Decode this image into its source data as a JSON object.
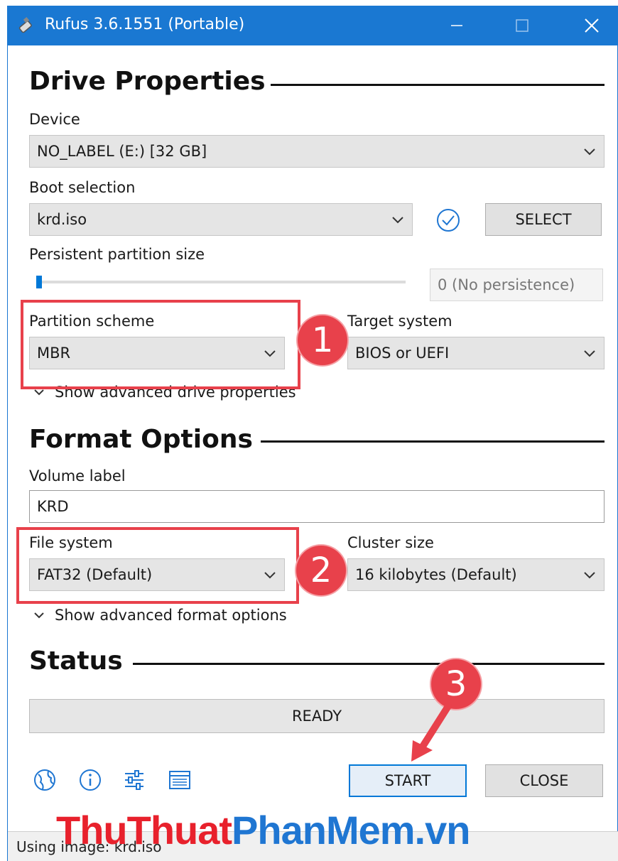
{
  "window": {
    "title": "Rufus 3.6.1551 (Portable)",
    "accent_color": "#1a78d2"
  },
  "drive_properties": {
    "heading": "Drive Properties",
    "device_label": "Device",
    "device_value": "NO_LABEL (E:) [32 GB]",
    "boot_selection_label": "Boot selection",
    "boot_selection_value": "krd.iso",
    "select_button": "SELECT",
    "persistent_label": "Persistent partition size",
    "persistent_value": "0 (No persistence)",
    "partition_scheme_label": "Partition scheme",
    "partition_scheme_value": "MBR",
    "target_system_label": "Target system",
    "target_system_value": "BIOS or UEFI",
    "advanced_toggle": "Show advanced drive properties"
  },
  "format_options": {
    "heading": "Format Options",
    "volume_label_label": "Volume label",
    "volume_label_value": "KRD",
    "file_system_label": "File system",
    "file_system_value": "FAT32 (Default)",
    "cluster_size_label": "Cluster size",
    "cluster_size_value": "16 kilobytes (Default)",
    "advanced_toggle": "Show advanced format options"
  },
  "status": {
    "heading": "Status",
    "text": "READY"
  },
  "actions": {
    "start": "START",
    "close": "CLOSE"
  },
  "toolbar_icons": [
    "globe-icon",
    "info-icon",
    "settings-icon",
    "log-icon"
  ],
  "footer": {
    "text": "Using image: krd.iso"
  },
  "annotations": {
    "badge_1": "1",
    "badge_2": "2",
    "badge_3": "3",
    "color": "#e8414b"
  },
  "watermark": {
    "part1": "ThuThuat",
    "part2": "PhanMem",
    "part3": ".vn"
  }
}
